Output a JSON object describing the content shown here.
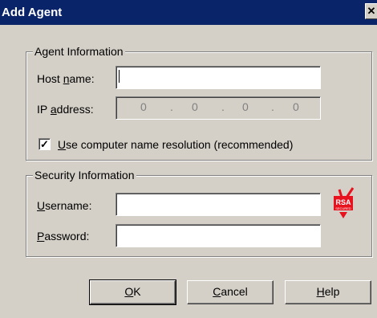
{
  "window": {
    "title": "Add Agent",
    "close_glyph": "✕"
  },
  "agent_info": {
    "legend": "Agent Information",
    "host_name": {
      "label_pre": "Host ",
      "label_accel": "n",
      "label_post": "ame:",
      "value": ""
    },
    "ip_address": {
      "label_pre": "IP ",
      "label_accel": "a",
      "label_post": "ddress:",
      "segments": [
        "0",
        "0",
        "0",
        "0"
      ],
      "dots": [
        ".",
        ".",
        "."
      ]
    },
    "use_name_resolution": {
      "label_accel": "U",
      "label_post": "se computer name resolution  (recommended)",
      "checked": true,
      "check_glyph": "✓"
    }
  },
  "security_info": {
    "legend": "Security Information",
    "username": {
      "label_accel": "U",
      "label_post": "sername:",
      "value": ""
    },
    "password": {
      "label_accel": "P",
      "label_post": "assword:",
      "value": ""
    },
    "logo": {
      "icon": "rsa-secured-icon",
      "text": "RSA",
      "subtext": "SECURED"
    }
  },
  "buttons": {
    "ok": {
      "accel": "O",
      "rest": "K"
    },
    "cancel": {
      "accel": "C",
      "rest": "ancel"
    },
    "help": {
      "accel": "H",
      "rest": "elp"
    }
  }
}
